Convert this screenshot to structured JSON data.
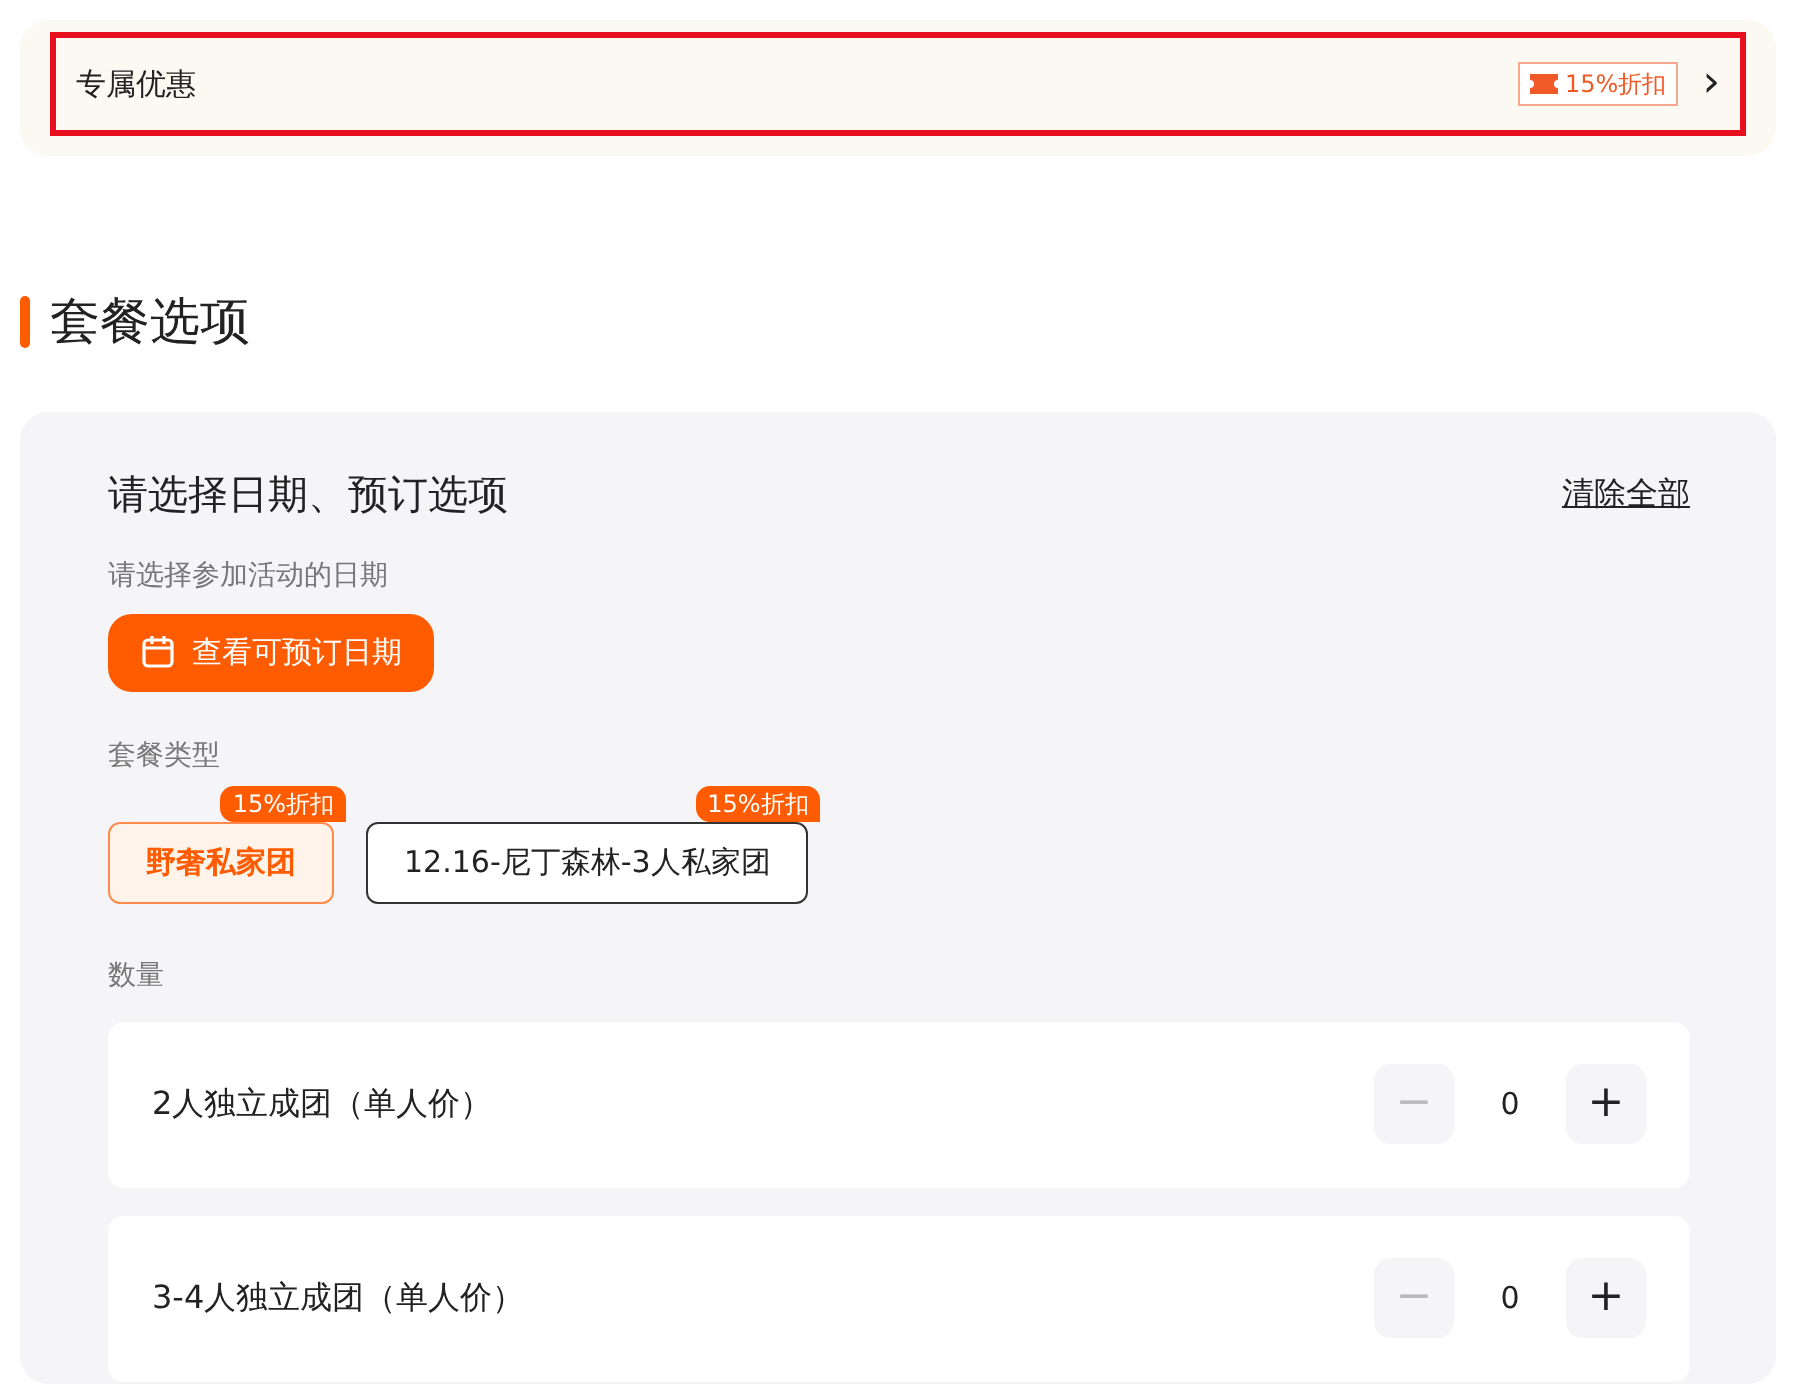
{
  "promo": {
    "label": "专属优惠",
    "tag": "15%折扣",
    "chevron": "›",
    "highlighted": true
  },
  "section": {
    "title": "套餐选项"
  },
  "card": {
    "heading": "请选择日期、预订选项",
    "clear_link": "清除全部",
    "date_label": "请选择参加活动的日期",
    "date_button": "查看可预订日期",
    "package_label": "套餐类型",
    "packages": [
      {
        "name": "野奢私家团",
        "badge": "15%折扣",
        "selected": true
      },
      {
        "name": "12.16-尼丁森林-3人私家团",
        "badge": "15%折扣",
        "selected": false
      }
    ],
    "quantity_label": "数量",
    "quantities": [
      {
        "name": "2人独立成团（单人价）",
        "minus": "−",
        "value": "0",
        "plus": "+",
        "minus_disabled": true
      },
      {
        "name": "3-4人独立成团（单人价）",
        "minus": "−",
        "value": "0",
        "plus": "+",
        "minus_disabled": true
      }
    ]
  }
}
